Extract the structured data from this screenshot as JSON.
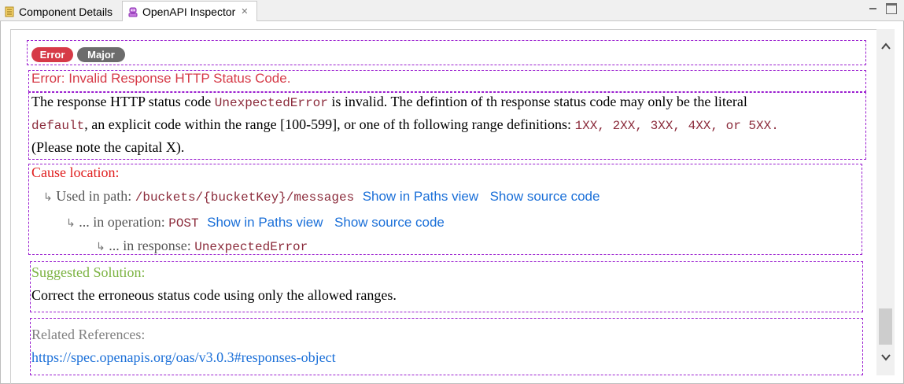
{
  "tabs": {
    "component_details": "Component Details",
    "openapi_inspector": "OpenAPI Inspector"
  },
  "badges": {
    "severity": "Error",
    "level": "Major"
  },
  "error": {
    "title": "Error: Invalid Response HTTP Status Code.",
    "line1_a": "The response HTTP status code ",
    "line1_code": "UnexpectedError",
    "line1_b": " is invalid. The defintion of th response status code may only be the literal",
    "line2_code": "default",
    "line2_a": ", an explicit code within the range [100-599], or one of th following range definitions: ",
    "line2_codes": "1XX, 2XX, 3XX, 4XX, or 5XX.",
    "line3": "(Please note the capital X)."
  },
  "cause": {
    "heading": "Cause location:",
    "path_label": "Used in path: ",
    "path_value": "/buckets/{bucketKey}/messages",
    "operation_label": "... in operation: ",
    "operation_value": "POST",
    "response_label": "... in response: ",
    "response_value": "UnexpectedError",
    "show_paths": "Show in Paths view",
    "show_source": "Show source code",
    "arrow_glyph": "↳"
  },
  "solution": {
    "heading": "Suggested Solution:",
    "text": "Correct the erroneous status code using only the allowed ranges."
  },
  "references": {
    "heading": "Related References:",
    "link": "https://spec.openapis.org/oas/v3.0.3#responses-object"
  },
  "colors": {
    "error_red": "#d63a47",
    "major_gray": "#6c6c6c",
    "heading_red": "#e02020",
    "solution_green": "#7cb342",
    "reference_gray": "#808080",
    "link_blue": "#1a6fd8",
    "code_maroon": "#8b2b3b",
    "box_border": "#9b1fd0"
  },
  "icons": {
    "component_tab": "document-icon",
    "inspector_tab": "openapi-robot-icon"
  }
}
